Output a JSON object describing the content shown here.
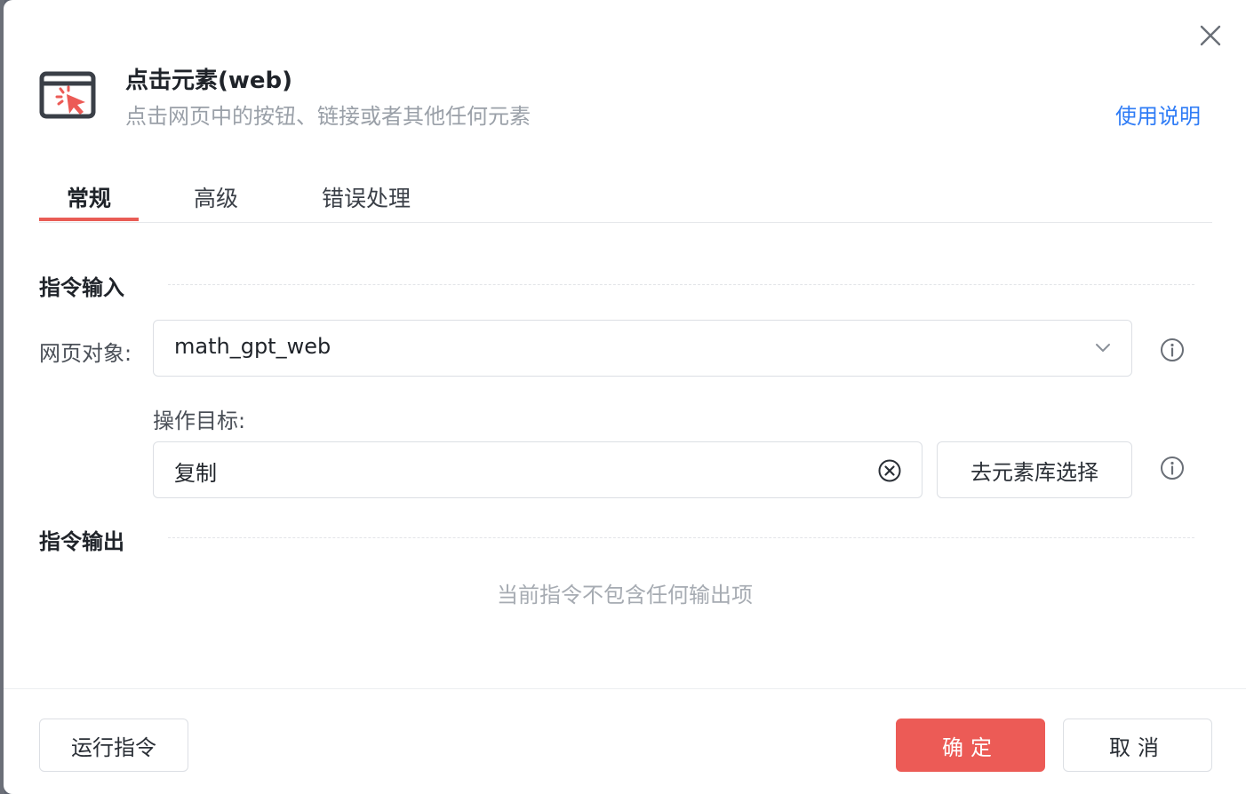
{
  "dialog": {
    "title": "点击元素(web)",
    "subtitle": "点击网页中的按钮、链接或者其他任何元素",
    "help_link": "使用说明",
    "close_icon": "close-icon",
    "header_icon": "click-element-icon"
  },
  "tabs": [
    {
      "label": "常规",
      "active": true
    },
    {
      "label": "高级",
      "active": false
    },
    {
      "label": "错误处理",
      "active": false
    }
  ],
  "input_section": {
    "title": "指令输入",
    "web_object": {
      "label": "网页对象:",
      "value": "math_gpt_web"
    },
    "target": {
      "label": "操作目标:",
      "value": "复制",
      "library_button": "去元素库选择"
    }
  },
  "output_section": {
    "title": "指令输出",
    "empty_message": "当前指令不包含任何输出项"
  },
  "footer": {
    "run_button": "运行指令",
    "confirm_button": "确定",
    "cancel_button": "取消"
  },
  "colors": {
    "accent": "#ec5b56",
    "link": "#2f7cf6"
  }
}
